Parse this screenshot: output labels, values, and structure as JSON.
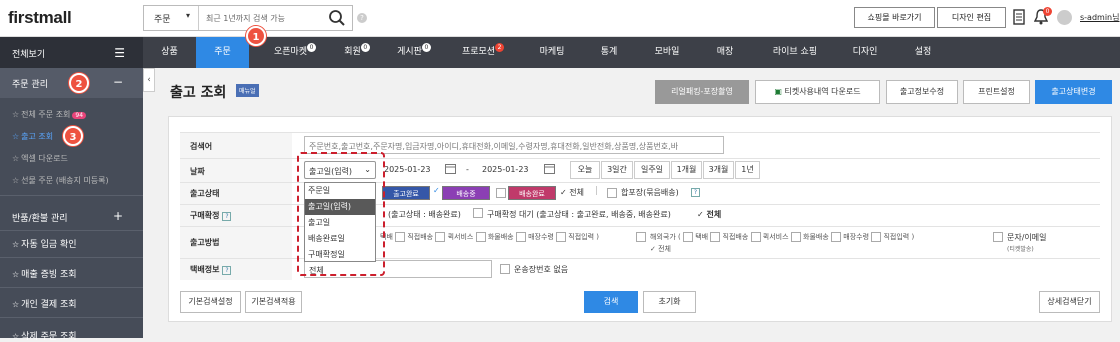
{
  "header": {
    "logo": "firstmall",
    "search_category": "주문",
    "search_placeholder": "최근 1년까지 검색 가능",
    "shop_button": "쇼핑몰 바로가기",
    "design_button": "디자인 편집",
    "notification_count": "0",
    "username": "s-admin님"
  },
  "sidebar": {
    "all_label": "전체보기",
    "sections": [
      {
        "label": "주문 관리",
        "toggle": "−"
      },
      {
        "label": "반품/환불 관리",
        "toggle": "+"
      }
    ],
    "order_items": [
      {
        "label": "전체 주문 조회",
        "badge": "94"
      },
      {
        "label": "출고 조회"
      },
      {
        "label": "엑셀 다운로드"
      },
      {
        "label": "선물 주문 (배송지 미등록)"
      }
    ],
    "nav_items": [
      "자동 입금 확인",
      "매출 증빙 조회",
      "개인 결제 조회",
      "삭제 주문 조회"
    ]
  },
  "menu": {
    "items": [
      {
        "label": "상품",
        "badge": ""
      },
      {
        "label": "주문",
        "badge": ""
      },
      {
        "label": "오픈마켓",
        "badge": "0"
      },
      {
        "label": "회원",
        "badge": "0"
      },
      {
        "label": "게시판",
        "badge": "0"
      },
      {
        "label": "프로모션",
        "badge": "2"
      },
      {
        "label": "마케팅",
        "badge": ""
      },
      {
        "label": "통계",
        "badge": ""
      },
      {
        "label": "모바일",
        "badge": ""
      },
      {
        "label": "매장",
        "badge": ""
      },
      {
        "label": "라이브 쇼핑",
        "badge": ""
      },
      {
        "label": "디자인",
        "badge": ""
      },
      {
        "label": "설정",
        "badge": ""
      }
    ]
  },
  "callouts": [
    "1",
    "2",
    "3"
  ],
  "page": {
    "title": "출고 조회",
    "manual_badge": "매뉴얼",
    "actions": [
      "리얼패킹-포장촬영",
      "티켓사용내역 다운로드",
      "출고정보수정",
      "프린트설정",
      "출고상태변경"
    ]
  },
  "form": {
    "labels": {
      "keyword": "검색어",
      "date": "날짜",
      "status": "출고상태",
      "confirm": "구매확정",
      "method": "출고방법",
      "courier": "택배정보"
    },
    "keyword_placeholder": "주문번호,출고번호,주문자명,입금자명,아이디,휴대전화,이메일,수령자명,휴대전화,일반전화,상품명,상품번호,바",
    "date_type": "출고일(입력)",
    "date_from": "2025-01-23",
    "date_tilde": "-",
    "date_to": "2025-01-23",
    "date_presets": [
      "오늘",
      "3일간",
      "일주일",
      "1개월",
      "3개월",
      "1년"
    ],
    "status_tags": [
      "출고완료",
      "배송중",
      "배송완료"
    ],
    "status_all": "✓ 전체",
    "status_combined": "합포장(묶음배송)",
    "confirm_text": "(출고상태 : 배송완료)",
    "confirm_wait": "구매확정 대기 (출고상태 : 출고완료, 배송중, 배송완료)",
    "confirm_all": "✓ 전체",
    "method_domestic": [
      "택배",
      "직접배송",
      "퀵서비스",
      "화물배송",
      "매장수령",
      "직접입력 )"
    ],
    "method_overseas_prefix": "해외국가 (",
    "method_overseas": [
      "택배",
      "직접배송",
      "퀵서비스",
      "화물배송",
      "매장수령",
      "직접입력 )"
    ],
    "method_all": "✓ 전체",
    "method_sms": "문자/이메일",
    "method_sms_sub": "(티켓발송)",
    "courier_value": "전체",
    "courier_none": "운송장번호 없음"
  },
  "dropdown": {
    "options": [
      "주문일",
      "출고일(입력)",
      "출고일",
      "배송완료일",
      "구매확정일"
    ],
    "active_index": 1
  },
  "bottom": {
    "default_setting": "기본검색설정",
    "default_apply": "기본검색적용",
    "search": "검색",
    "reset": "초기화",
    "detail_close": "상세검색닫기"
  }
}
